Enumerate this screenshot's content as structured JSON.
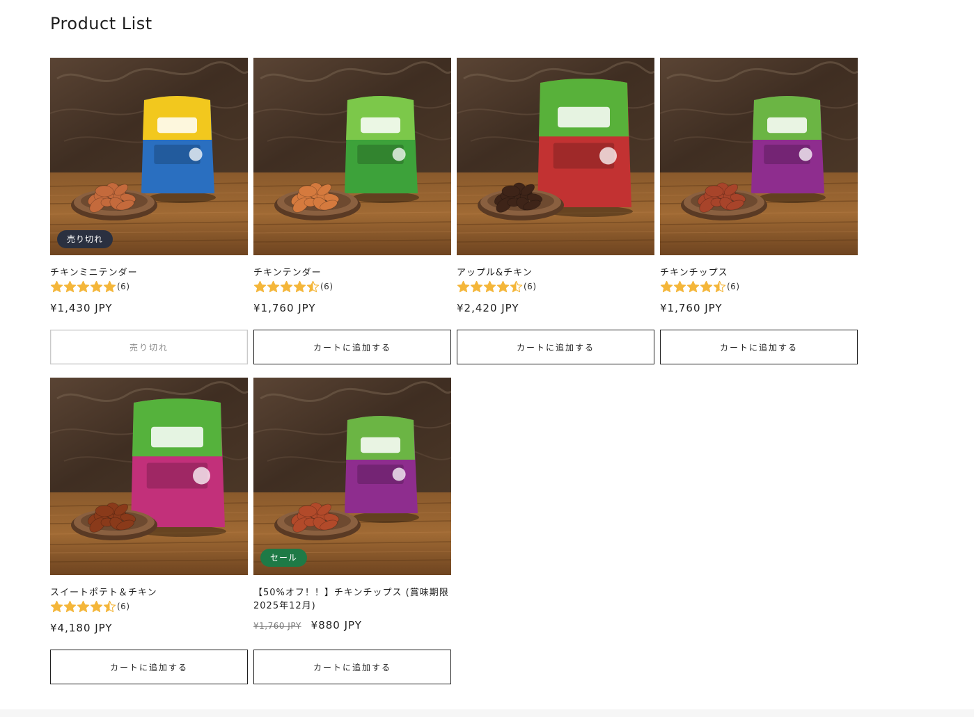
{
  "page": {
    "title": "Product List"
  },
  "colors": {
    "star": "#f4b63a",
    "soldout_badge": "#2a3040",
    "sale_badge": "#1e7a46",
    "button_border": "#1f1f1f"
  },
  "products": [
    {
      "name": "チキンミニテンダー",
      "rating": 5,
      "review_count": "(6)",
      "price": "¥1,430 JPY",
      "badge": "売り切れ",
      "button_label": "売り切れ",
      "button_disabled": true,
      "package_color": "#2a6fc0",
      "package_color2": "#f2c81e",
      "treat_color": "#c46a3c"
    },
    {
      "name": "チキンテンダー",
      "rating": 4.5,
      "review_count": "(6)",
      "price": "¥1,760 JPY",
      "button_label": "カートに追加する",
      "package_color": "#3da23a",
      "package_color2": "#7cc84a",
      "treat_color": "#d57a3e"
    },
    {
      "name": "アップル&チキン",
      "rating": 4.5,
      "review_count": "(6)",
      "price": "¥2,420 JPY",
      "button_label": "カートに追加する",
      "package_color": "#c23232",
      "package_color2": "#58b13a",
      "treat_color": "#3e2418"
    },
    {
      "name": "チキンチップス",
      "rating": 4.5,
      "review_count": "(6)",
      "price": "¥1,760 JPY",
      "button_label": "カートに追加する",
      "package_color": "#8e2d8e",
      "package_color2": "#6bb544",
      "treat_color": "#a8442a"
    },
    {
      "name": "スイートポテト＆チキン",
      "rating": 4.5,
      "review_count": "(6)",
      "price": "¥4,180 JPY",
      "button_label": "カートに追加する",
      "package_color": "#c2307a",
      "package_color2": "#55b23c",
      "treat_color": "#8a3a1a"
    },
    {
      "name": "【50%オフ！！】チキンチップス (賞味期限 2025年12月)",
      "name_line1": "【50%オフ！！】チキンチップス (賞味期限",
      "name_line2": "2025年12月)",
      "compare_price": "¥1,760 JPY",
      "price": "¥880 JPY",
      "badge": "セール",
      "button_label": "カートに追加する",
      "package_color": "#8e2d8e",
      "package_color2": "#6bb544",
      "treat_color": "#b24a2a"
    }
  ]
}
